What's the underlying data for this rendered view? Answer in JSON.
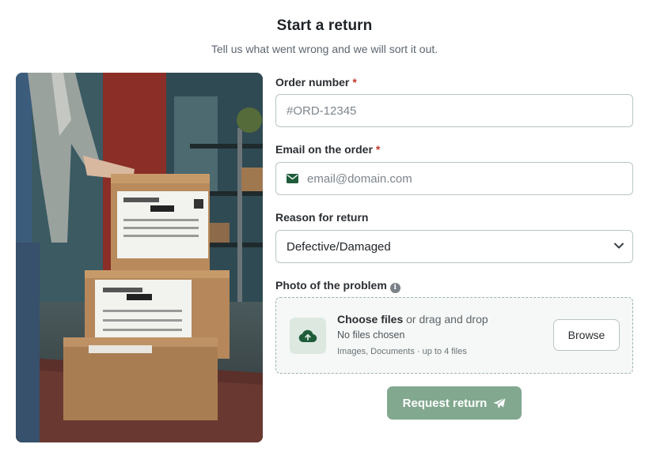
{
  "header": {
    "title": "Start a return",
    "subtitle": "Tell us what went wrong and we will sort it out."
  },
  "form": {
    "order_number": {
      "label": "Order number",
      "required_mark": "*",
      "placeholder": "#ORD-12345",
      "value": ""
    },
    "email": {
      "label": "Email on the order",
      "required_mark": "*",
      "placeholder": "email@domain.com",
      "value": "",
      "icon": "envelope-icon"
    },
    "reason": {
      "label": "Reason for return",
      "selected": "Defective/Damaged",
      "icon": "chevron-down-icon"
    },
    "photo": {
      "label": "Photo of the problem",
      "info_icon": "info-icon",
      "choose_label": "Choose files",
      "drag_label": "or drag and drop",
      "status": "No files chosen",
      "hint": "Images, Documents · up to 4 files",
      "browse_label": "Browse",
      "upload_icon": "cloud-upload-icon"
    },
    "submit": {
      "label": "Request return",
      "icon": "paper-plane-icon"
    }
  },
  "colors": {
    "accent": "#82a88f",
    "accent_dark": "#1e5c3a",
    "required": "#c0392b",
    "border": "#b9c6bf",
    "dropzone_bg": "#f5f8f6"
  }
}
